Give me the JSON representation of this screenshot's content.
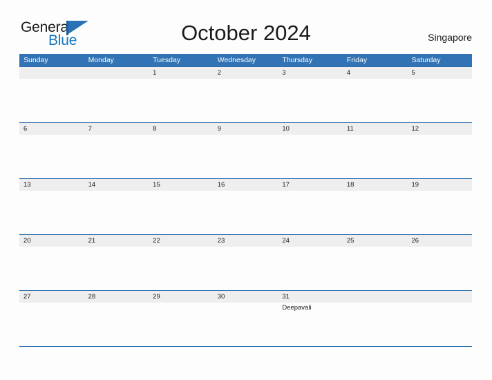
{
  "brand": {
    "name_part1": "General",
    "name_part2": "Blue",
    "flag_icon": "flag-icon",
    "accent_blue": "#1175c2"
  },
  "header": {
    "title": "October 2024",
    "region": "Singapore"
  },
  "theme": {
    "header_bar": "#3173b4",
    "row_band": "#eeeeee",
    "row_rule": "#2f6fae",
    "page_background": "#fdfdfd",
    "text": "#1a1a1a"
  },
  "calendar": {
    "weekdays": [
      "Sunday",
      "Monday",
      "Tuesday",
      "Wednesday",
      "Thursday",
      "Friday",
      "Saturday"
    ],
    "weeks": [
      [
        {
          "date": ""
        },
        {
          "date": ""
        },
        {
          "date": "1"
        },
        {
          "date": "2"
        },
        {
          "date": "3"
        },
        {
          "date": "4"
        },
        {
          "date": "5"
        }
      ],
      [
        {
          "date": "6"
        },
        {
          "date": "7"
        },
        {
          "date": "8"
        },
        {
          "date": "9"
        },
        {
          "date": "10"
        },
        {
          "date": "11"
        },
        {
          "date": "12"
        }
      ],
      [
        {
          "date": "13"
        },
        {
          "date": "14"
        },
        {
          "date": "15"
        },
        {
          "date": "16"
        },
        {
          "date": "17"
        },
        {
          "date": "18"
        },
        {
          "date": "19"
        }
      ],
      [
        {
          "date": "20"
        },
        {
          "date": "21"
        },
        {
          "date": "22"
        },
        {
          "date": "23"
        },
        {
          "date": "24"
        },
        {
          "date": "25"
        },
        {
          "date": "26"
        }
      ],
      [
        {
          "date": "27"
        },
        {
          "date": "28"
        },
        {
          "date": "29"
        },
        {
          "date": "30"
        },
        {
          "date": "31",
          "event": "Deepavali"
        },
        {
          "date": ""
        },
        {
          "date": ""
        }
      ]
    ]
  }
}
